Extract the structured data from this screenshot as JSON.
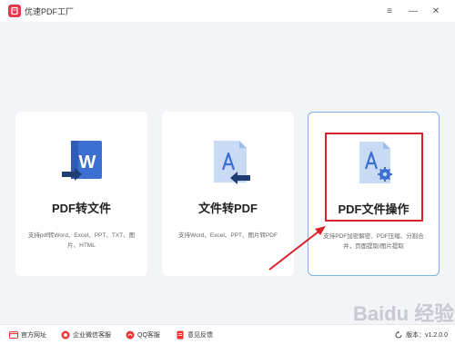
{
  "window": {
    "title": "优速PDF工厂",
    "menu_icon": "≡",
    "minimize_icon": "—",
    "close_icon": "✕"
  },
  "cards": [
    {
      "title": "PDF转文件",
      "description": "支持pdf转Word、Excel、PPT、TXT、图片、HTML",
      "icon": "pdf-to-word-icon"
    },
    {
      "title": "文件转PDF",
      "description": "支持Word、Excel、PPT、图片转PDF",
      "icon": "file-to-pdf-icon"
    },
    {
      "title": "PDF文件操作",
      "description": "支持PDF加密解密、PDF压缩、分割合并，页面提取/图片提取",
      "icon": "pdf-operations-icon",
      "selected": true
    }
  ],
  "footer": {
    "links": [
      {
        "label": "官方网址",
        "icon": "website-icon"
      },
      {
        "label": "企业微信客服",
        "icon": "wechat-service-icon"
      },
      {
        "label": "QQ客服",
        "icon": "qq-service-icon"
      },
      {
        "label": "意见反馈",
        "icon": "feedback-icon"
      }
    ],
    "version_label": "版本：",
    "version": "v1.2.0.0"
  },
  "watermark": "Baidu 经验",
  "colors": {
    "accent": "#3a7bd5",
    "highlight": "#d9232a",
    "brand": "#e8374f"
  }
}
